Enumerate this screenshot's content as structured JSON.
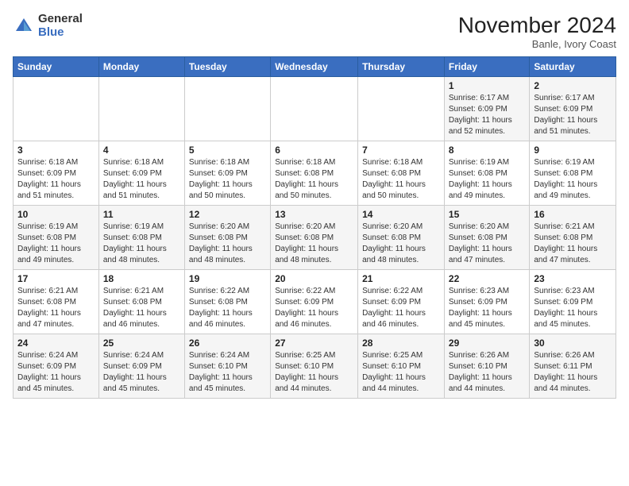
{
  "header": {
    "logo_general": "General",
    "logo_blue": "Blue",
    "month_title": "November 2024",
    "location": "Banle, Ivory Coast"
  },
  "weekdays": [
    "Sunday",
    "Monday",
    "Tuesday",
    "Wednesday",
    "Thursday",
    "Friday",
    "Saturday"
  ],
  "weeks": [
    [
      {
        "day": "",
        "info": ""
      },
      {
        "day": "",
        "info": ""
      },
      {
        "day": "",
        "info": ""
      },
      {
        "day": "",
        "info": ""
      },
      {
        "day": "",
        "info": ""
      },
      {
        "day": "1",
        "info": "Sunrise: 6:17 AM\nSunset: 6:09 PM\nDaylight: 11 hours and 52 minutes."
      },
      {
        "day": "2",
        "info": "Sunrise: 6:17 AM\nSunset: 6:09 PM\nDaylight: 11 hours and 51 minutes."
      }
    ],
    [
      {
        "day": "3",
        "info": "Sunrise: 6:18 AM\nSunset: 6:09 PM\nDaylight: 11 hours and 51 minutes."
      },
      {
        "day": "4",
        "info": "Sunrise: 6:18 AM\nSunset: 6:09 PM\nDaylight: 11 hours and 51 minutes."
      },
      {
        "day": "5",
        "info": "Sunrise: 6:18 AM\nSunset: 6:09 PM\nDaylight: 11 hours and 50 minutes."
      },
      {
        "day": "6",
        "info": "Sunrise: 6:18 AM\nSunset: 6:08 PM\nDaylight: 11 hours and 50 minutes."
      },
      {
        "day": "7",
        "info": "Sunrise: 6:18 AM\nSunset: 6:08 PM\nDaylight: 11 hours and 50 minutes."
      },
      {
        "day": "8",
        "info": "Sunrise: 6:19 AM\nSunset: 6:08 PM\nDaylight: 11 hours and 49 minutes."
      },
      {
        "day": "9",
        "info": "Sunrise: 6:19 AM\nSunset: 6:08 PM\nDaylight: 11 hours and 49 minutes."
      }
    ],
    [
      {
        "day": "10",
        "info": "Sunrise: 6:19 AM\nSunset: 6:08 PM\nDaylight: 11 hours and 49 minutes."
      },
      {
        "day": "11",
        "info": "Sunrise: 6:19 AM\nSunset: 6:08 PM\nDaylight: 11 hours and 48 minutes."
      },
      {
        "day": "12",
        "info": "Sunrise: 6:20 AM\nSunset: 6:08 PM\nDaylight: 11 hours and 48 minutes."
      },
      {
        "day": "13",
        "info": "Sunrise: 6:20 AM\nSunset: 6:08 PM\nDaylight: 11 hours and 48 minutes."
      },
      {
        "day": "14",
        "info": "Sunrise: 6:20 AM\nSunset: 6:08 PM\nDaylight: 11 hours and 48 minutes."
      },
      {
        "day": "15",
        "info": "Sunrise: 6:20 AM\nSunset: 6:08 PM\nDaylight: 11 hours and 47 minutes."
      },
      {
        "day": "16",
        "info": "Sunrise: 6:21 AM\nSunset: 6:08 PM\nDaylight: 11 hours and 47 minutes."
      }
    ],
    [
      {
        "day": "17",
        "info": "Sunrise: 6:21 AM\nSunset: 6:08 PM\nDaylight: 11 hours and 47 minutes."
      },
      {
        "day": "18",
        "info": "Sunrise: 6:21 AM\nSunset: 6:08 PM\nDaylight: 11 hours and 46 minutes."
      },
      {
        "day": "19",
        "info": "Sunrise: 6:22 AM\nSunset: 6:08 PM\nDaylight: 11 hours and 46 minutes."
      },
      {
        "day": "20",
        "info": "Sunrise: 6:22 AM\nSunset: 6:09 PM\nDaylight: 11 hours and 46 minutes."
      },
      {
        "day": "21",
        "info": "Sunrise: 6:22 AM\nSunset: 6:09 PM\nDaylight: 11 hours and 46 minutes."
      },
      {
        "day": "22",
        "info": "Sunrise: 6:23 AM\nSunset: 6:09 PM\nDaylight: 11 hours and 45 minutes."
      },
      {
        "day": "23",
        "info": "Sunrise: 6:23 AM\nSunset: 6:09 PM\nDaylight: 11 hours and 45 minutes."
      }
    ],
    [
      {
        "day": "24",
        "info": "Sunrise: 6:24 AM\nSunset: 6:09 PM\nDaylight: 11 hours and 45 minutes."
      },
      {
        "day": "25",
        "info": "Sunrise: 6:24 AM\nSunset: 6:09 PM\nDaylight: 11 hours and 45 minutes."
      },
      {
        "day": "26",
        "info": "Sunrise: 6:24 AM\nSunset: 6:10 PM\nDaylight: 11 hours and 45 minutes."
      },
      {
        "day": "27",
        "info": "Sunrise: 6:25 AM\nSunset: 6:10 PM\nDaylight: 11 hours and 44 minutes."
      },
      {
        "day": "28",
        "info": "Sunrise: 6:25 AM\nSunset: 6:10 PM\nDaylight: 11 hours and 44 minutes."
      },
      {
        "day": "29",
        "info": "Sunrise: 6:26 AM\nSunset: 6:10 PM\nDaylight: 11 hours and 44 minutes."
      },
      {
        "day": "30",
        "info": "Sunrise: 6:26 AM\nSunset: 6:11 PM\nDaylight: 11 hours and 44 minutes."
      }
    ]
  ]
}
